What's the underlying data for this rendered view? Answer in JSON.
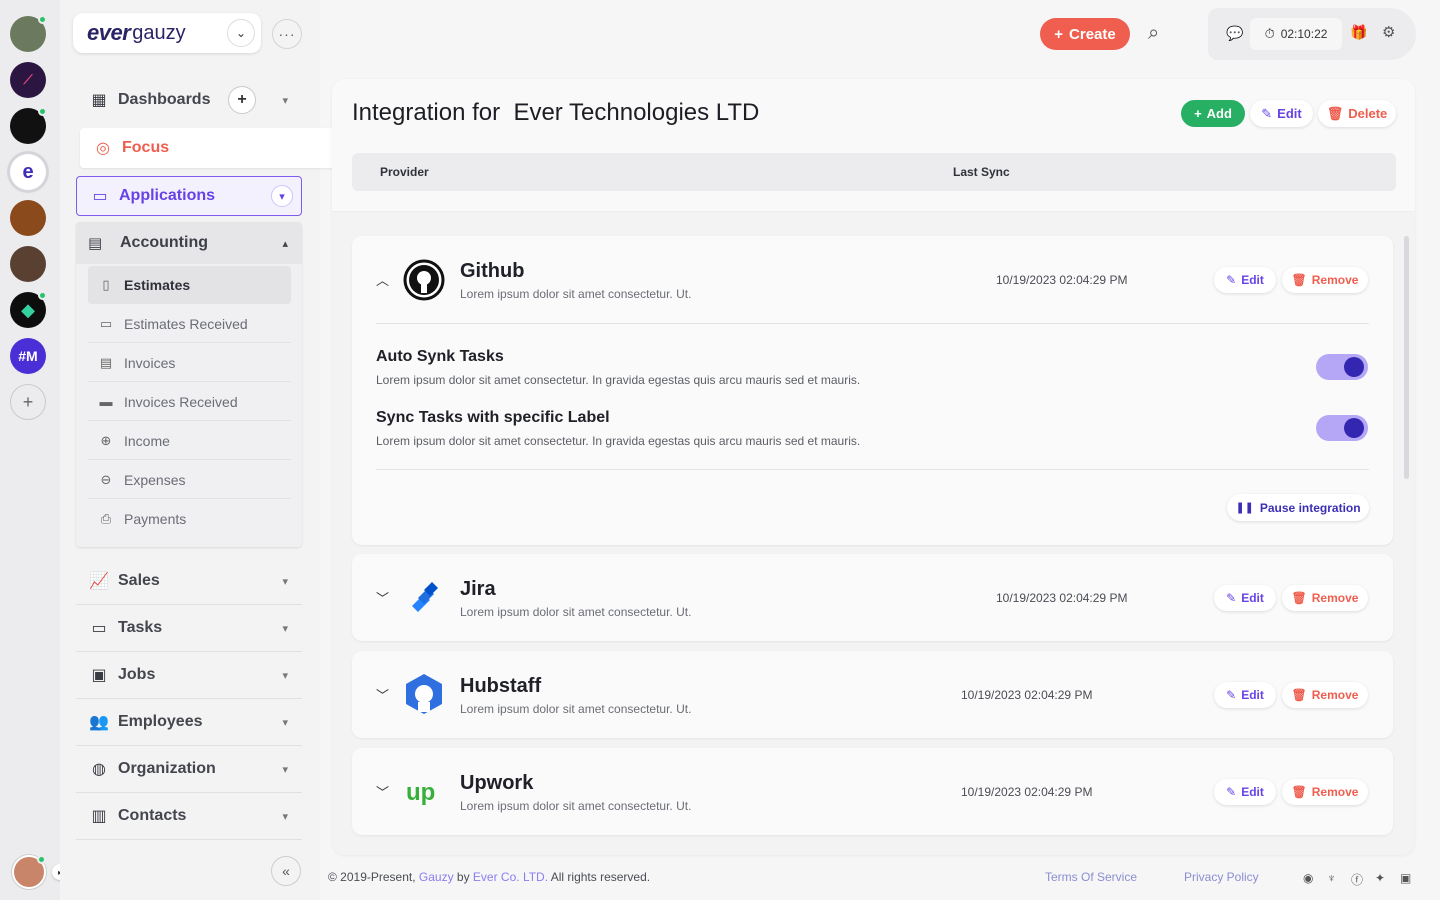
{
  "workspaces": [
    {
      "name": "workspace-1",
      "color": "#6b7a5e",
      "label": "",
      "online": true
    },
    {
      "name": "workspace-2",
      "color": "#2a1640",
      "label": "",
      "online": false
    },
    {
      "name": "workspace-3",
      "color": "#111111",
      "label": "",
      "online": true
    },
    {
      "name": "workspace-ever",
      "color": "#ffffff",
      "label": "e",
      "online": true
    },
    {
      "name": "workspace-5",
      "color": "#8a4a1c",
      "label": "",
      "online": false
    },
    {
      "name": "workspace-6",
      "color": "#5a4030",
      "label": "",
      "online": false
    },
    {
      "name": "workspace-7",
      "color": "#0d0d0d",
      "label": "",
      "online": true
    },
    {
      "name": "workspace-m",
      "color": "#4b2fd6",
      "label": "#M",
      "online": false
    }
  ],
  "brand": {
    "part1": "ever",
    "part2": "gauzy"
  },
  "sidebar": {
    "dashboards": "Dashboards",
    "focus": "Focus",
    "applications": "Applications",
    "accounting": "Accounting",
    "accounting_items": [
      "Estimates",
      "Estimates Received",
      "Invoices",
      "Invoices Received",
      "Income",
      "Expenses",
      "Payments"
    ],
    "sales": "Sales",
    "tasks": "Tasks",
    "jobs": "Jobs",
    "employees": "Employees",
    "organization": "Organization",
    "contacts": "Contacts"
  },
  "header": {
    "create": "Create",
    "timer": "02:10:22"
  },
  "page": {
    "title_prefix": "Integration for ",
    "organization": "Ever Technologies LTD",
    "add": "Add",
    "edit": "Edit",
    "delete": "Delete",
    "columns": {
      "provider": "Provider",
      "last_sync": "Last Sync"
    }
  },
  "integrations": [
    {
      "name": "Github",
      "desc": "Lorem ipsum dolor sit amet consectetur. Ut.",
      "last_sync": "10/19/2023 02:04:29 PM",
      "edit": "Edit",
      "remove": "Remove",
      "expanded": true
    },
    {
      "name": "Jira",
      "desc": "Lorem ipsum dolor sit amet consectetur. Ut.",
      "last_sync": "10/19/2023 02:04:29 PM",
      "edit": "Edit",
      "remove": "Remove",
      "expanded": false
    },
    {
      "name": "Hubstaff",
      "desc": "Lorem ipsum dolor sit amet consectetur. Ut.",
      "last_sync": "10/19/2023 02:04:29 PM",
      "edit": "Edit",
      "remove": "Remove",
      "expanded": false
    },
    {
      "name": "Upwork",
      "desc": "Lorem ipsum dolor sit amet consectetur. Ut.",
      "last_sync": "10/19/2023 02:04:29 PM",
      "edit": "Edit",
      "remove": "Remove",
      "expanded": false
    }
  ],
  "github_settings": [
    {
      "title": "Auto Synk Tasks",
      "desc": "Lorem ipsum dolor sit amet consectetur. In gravida egestas quis arcu mauris sed et mauris.",
      "enabled": true
    },
    {
      "title": "Sync Tasks with specific Label",
      "desc": "Lorem ipsum dolor sit amet consectetur. In gravida egestas quis arcu mauris sed et mauris.",
      "enabled": true
    }
  ],
  "pause_label": "Pause integration",
  "footer": {
    "copyright": "© 2019-Present, ",
    "gauzy": "Gauzy",
    "by": " by ",
    "company": "Ever Co. LTD.",
    "rights": " All rights reserved.",
    "terms": "Terms Of Service",
    "privacy": "Privacy Policy"
  },
  "colors": {
    "accent": "#6743e6",
    "danger": "#ef5e4e",
    "success": "#27b063"
  }
}
